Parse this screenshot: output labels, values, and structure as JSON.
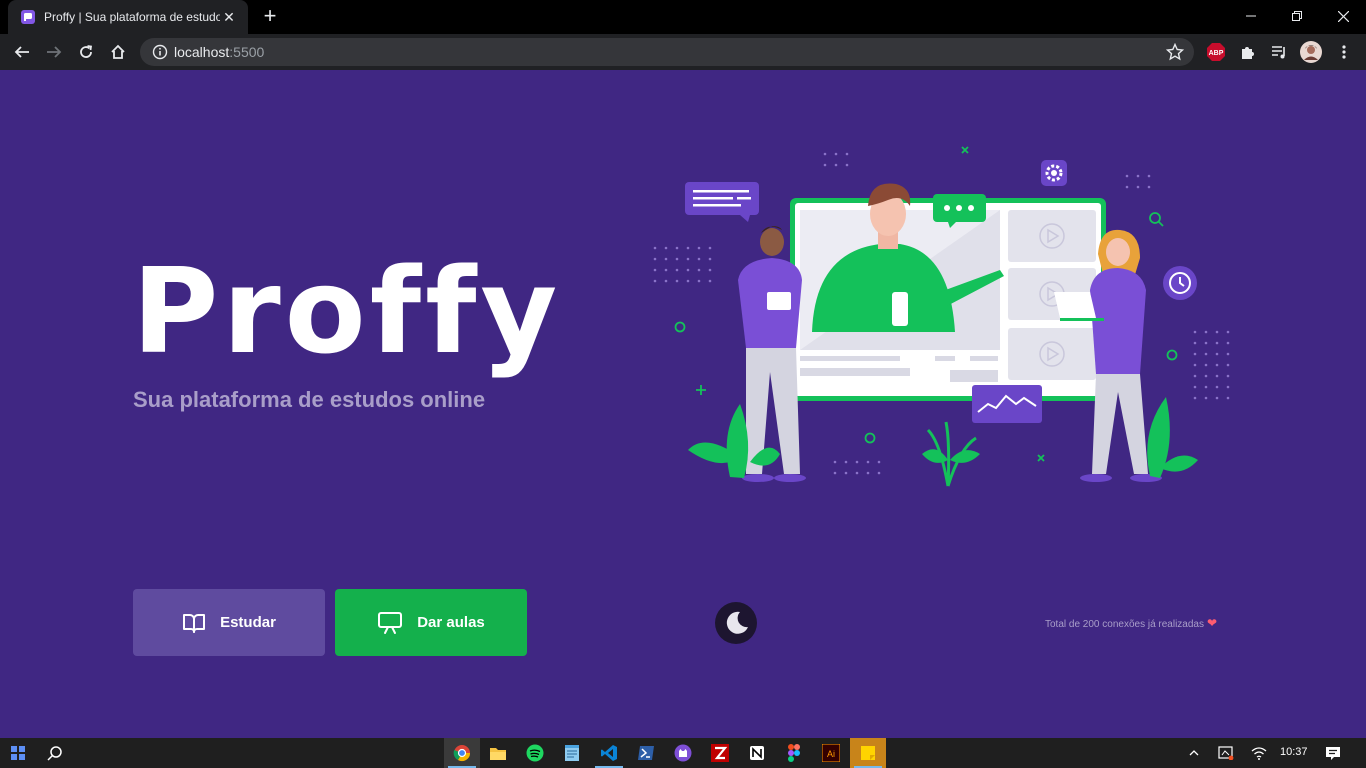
{
  "browser": {
    "tab_title": "Proffy | Sua plataforma de estudos online",
    "new_tab": "+",
    "url_host": "localhost",
    "url_port": ":5500",
    "extension_abp": "ABP"
  },
  "page": {
    "logo": "Proffy",
    "subtitle": "Sua plataforma de estudos online",
    "buttons": {
      "study": "Estudar",
      "teach": "Dar aulas"
    },
    "connections": "Total de 200 conexões já realizadas",
    "colors": {
      "background": "#402783",
      "study_button": "#5f4b9f",
      "teach_button": "#14b04c",
      "subtitle": "#a99ec9"
    }
  },
  "taskbar": {
    "time": "10:37",
    "apps": [
      "chrome-icon",
      "file-explorer-icon",
      "spotify-icon",
      "notepad-icon",
      "vscode-icon",
      "powershell-icon",
      "github-desktop-icon",
      "filezilla-icon",
      "notion-icon",
      "figma-icon",
      "illustrator-icon",
      "sticky-notes-icon"
    ]
  }
}
